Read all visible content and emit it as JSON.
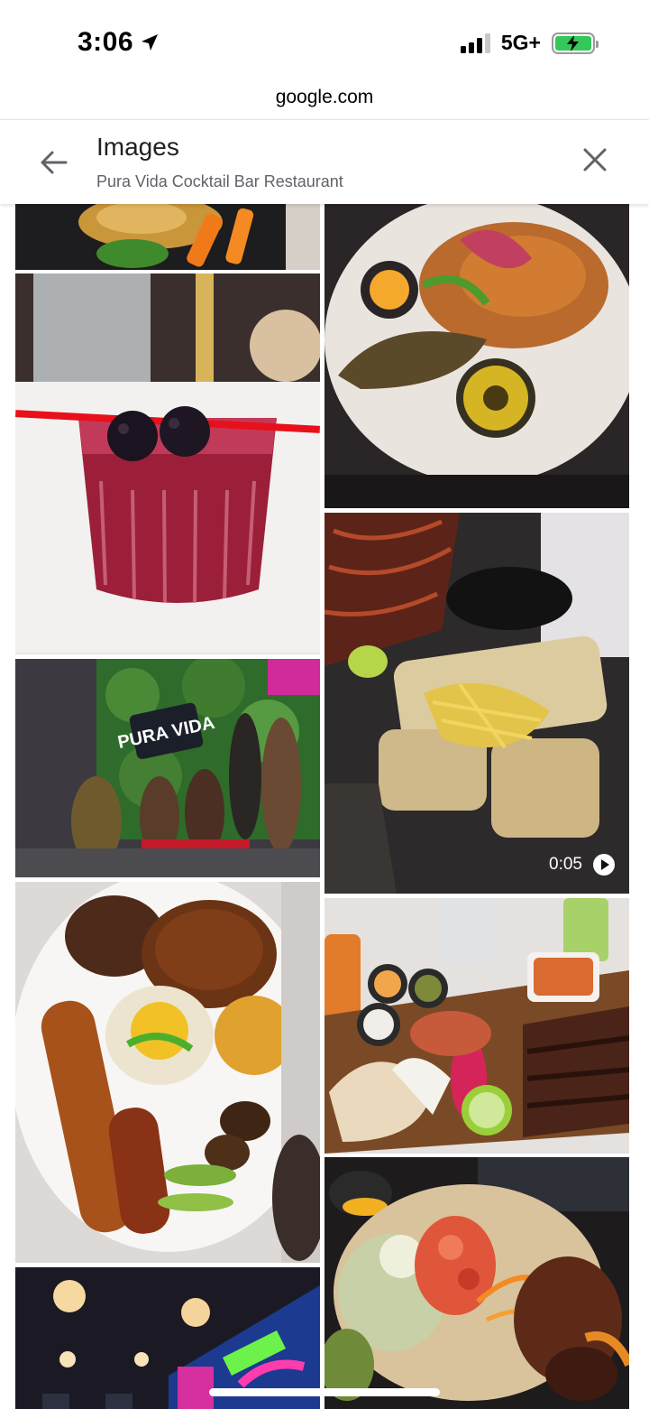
{
  "status_bar": {
    "time": "3:06",
    "network": "5G+",
    "signal_bars_active": 3,
    "battery_state": "charging",
    "accent_color": "#34c759"
  },
  "browser": {
    "url": "google.com"
  },
  "header": {
    "title": "Images",
    "subtitle": "Pura Vida Cocktail Bar Restaurant",
    "back_icon": "arrow-left-icon",
    "close_icon": "close-icon"
  },
  "grid": {
    "tiles": [
      {
        "id": "food-plate-partial",
        "description_icon": "image-thumbnail"
      },
      {
        "id": "cocktail-blackberry",
        "description_icon": "image-thumbnail"
      },
      {
        "id": "group-photo-wall",
        "description_icon": "image-thumbnail"
      },
      {
        "id": "platter-plantain",
        "description_icon": "image-thumbnail"
      },
      {
        "id": "neon-bar",
        "description_icon": "image-thumbnail"
      },
      {
        "id": "plate-tostones",
        "description_icon": "image-thumbnail"
      },
      {
        "id": "sushi-rolls-video",
        "description_icon": "image-thumbnail",
        "video_duration": "0:05"
      },
      {
        "id": "steak-board",
        "description_icon": "image-thumbnail"
      },
      {
        "id": "salad-bowl",
        "description_icon": "image-thumbnail"
      }
    ],
    "wall_sign_text": "PURA VIDA"
  }
}
